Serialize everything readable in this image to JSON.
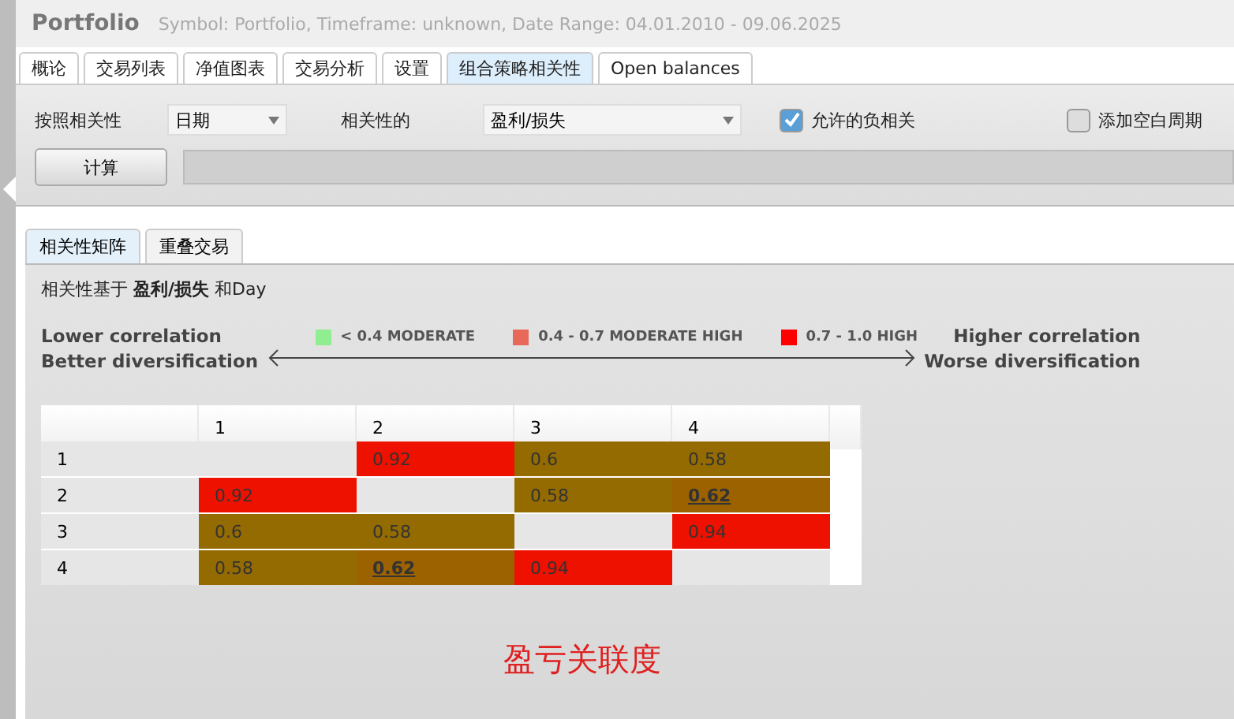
{
  "header": {
    "title": "Portfolio",
    "subtitle": "Symbol: Portfolio, Timeframe: unknown, Date Range: 04.01.2010 - 09.06.2025"
  },
  "tabs": [
    {
      "label": "概论",
      "selected": false
    },
    {
      "label": "交易列表",
      "selected": false
    },
    {
      "label": "净值图表",
      "selected": false
    },
    {
      "label": "交易分析",
      "selected": false
    },
    {
      "label": "设置",
      "selected": false
    },
    {
      "label": "组合策略相关性",
      "selected": true
    },
    {
      "label": "Open balances",
      "selected": false
    }
  ],
  "controls": {
    "by_label": "按照相关性",
    "by_value": "日期",
    "of_label": "相关性的",
    "of_value": "盈利/损失",
    "checkboxes": [
      {
        "label": "允许的负相关",
        "checked": true
      },
      {
        "label": "添加空白周期",
        "checked": false
      }
    ],
    "calculate": "计算",
    "progress": {
      "level": 0
    }
  },
  "subtabs": [
    {
      "label": "相关性矩阵",
      "selected": true
    },
    {
      "label": "重叠交易",
      "selected": false
    }
  ],
  "caption": "相关性基于 **盈利/损失** 和Day",
  "legend": {
    "left": [
      "Lower correlation",
      "Better diversification"
    ],
    "right": [
      "Higher correlation",
      "Worse diversification"
    ],
    "items": [
      {
        "label": "< 0.4 MODERATE",
        "color": "#90ee90"
      },
      {
        "label": "0.4 - 0.7 MODERATE HIGH",
        "color": "#e8685a"
      },
      {
        "label": "0.7 - 1.0 HIGH",
        "color": "#ff0000"
      }
    ]
  },
  "matrix": {
    "columns": [
      "1",
      "2",
      "3",
      "4"
    ],
    "rows": [
      {
        "label": "1",
        "cells": [
          {
            "color": "#e6e6e6"
          },
          {
            "text": "0.92",
            "color": "#ee1100",
            "emphasized": false
          },
          {
            "text": "0.6",
            "color": "#946b00",
            "emphasized": false
          },
          {
            "text": "0.58",
            "color": "#946b00",
            "emphasized": false
          }
        ]
      },
      {
        "label": "2",
        "cells": [
          {
            "text": "0.92",
            "color": "#ee1100",
            "emphasized": false
          },
          {
            "color": "#e6e6e6"
          },
          {
            "text": "0.58",
            "color": "#946b00",
            "emphasized": false
          },
          {
            "text": "0.62",
            "color": "#9c6200",
            "emphasized": true
          }
        ]
      },
      {
        "label": "3",
        "cells": [
          {
            "text": "0.6",
            "color": "#946b00",
            "emphasized": false
          },
          {
            "text": "0.58",
            "color": "#946b00",
            "emphasized": false
          },
          {
            "color": "#e6e6e6"
          },
          {
            "text": "0.94",
            "color": "#ee1100",
            "emphasized": false
          }
        ]
      },
      {
        "label": "4",
        "cells": [
          {
            "text": "0.58",
            "color": "#946b00",
            "emphasized": false
          },
          {
            "text": "0.62",
            "color": "#9c6200",
            "emphasized": true
          },
          {
            "text": "0.94",
            "color": "#ee1100",
            "emphasized": false
          },
          {
            "color": "#e6e6e6"
          }
        ]
      }
    ]
  },
  "annotation": "盈亏关联度"
}
